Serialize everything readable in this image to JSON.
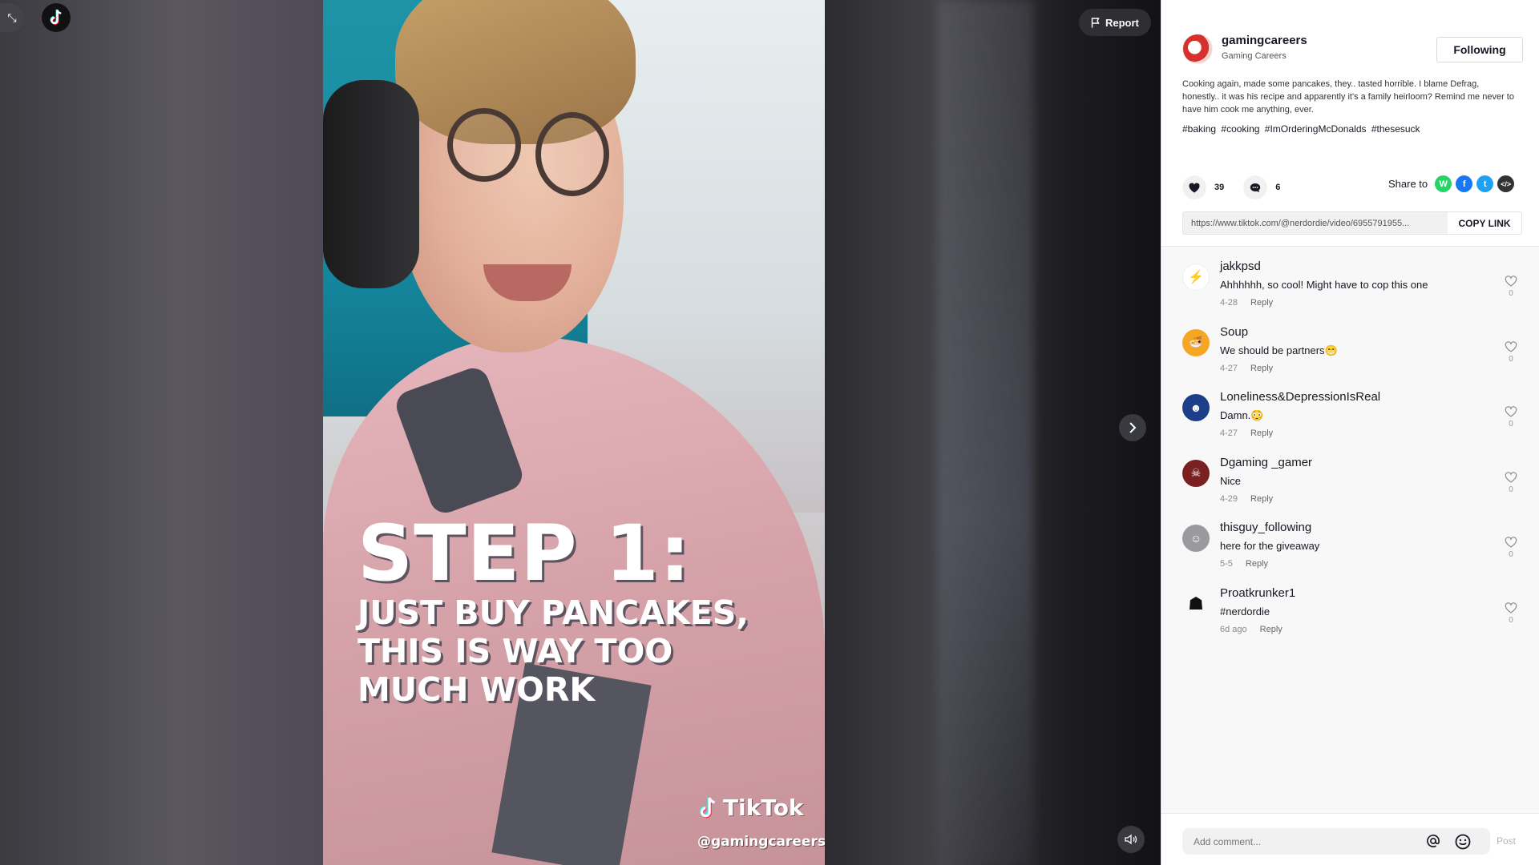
{
  "player": {
    "overlay_title": "STEP 1:",
    "overlay_lines": [
      "JUST BUY PANCAKES,",
      "THIS IS WAY TOO",
      "MUCH WORK"
    ],
    "watermark_brand": "TikTok",
    "watermark_handle": "@gamingcareers",
    "report_label": "Report"
  },
  "post": {
    "username": "gamingcareers",
    "nickname": "Gaming Careers",
    "follow_label": "Following",
    "description": "Cooking again, made some pancakes, they.. tasted horrible. I blame Defrag, honestly.. it was his recipe and apparently it's a family heirloom? Remind me never to have him cook me anything, ever.",
    "hashtags": [
      "#baking",
      "#cooking",
      "#ImOrderingMcDonalds",
      "#thesesuck"
    ],
    "likes": "39",
    "comments_count": "6",
    "share_label": "Share to",
    "link_url": "https://www.tiktok.com/@nerdordie/video/6955791955...",
    "copy_link_label": "COPY LINK"
  },
  "comments": [
    {
      "name": "jakkpsd",
      "text": "Ahhhhhh, so cool! Might have to cop this one",
      "date": "4-28",
      "reply": "Reply",
      "likes": "0"
    },
    {
      "name": "Soup",
      "text": "We should be partners😁",
      "date": "4-27",
      "reply": "Reply",
      "likes": "0"
    },
    {
      "name": "Loneliness&DepressionIsReal",
      "text": "Damn.😳",
      "date": "4-27",
      "reply": "Reply",
      "likes": "0"
    },
    {
      "name": "Dgaming _gamer",
      "text": "Nice",
      "date": "4-29",
      "reply": "Reply",
      "likes": "0"
    },
    {
      "name": "thisguy_following",
      "text": "here for the giveaway",
      "date": "5-5",
      "reply": "Reply",
      "likes": "0"
    },
    {
      "name": "Proatkrunker1",
      "text": "#nerdordie",
      "date": "6d ago",
      "reply": "Reply",
      "likes": "0"
    }
  ],
  "compose": {
    "placeholder": "Add comment...",
    "post_label": "Post"
  },
  "colors": {
    "whatsapp": "#25d366",
    "facebook": "#1877f2",
    "twitter": "#1da1f2",
    "embed": "#333333",
    "soup_avatar": "#f5a623",
    "lonely_avatar": "#1d3f8a",
    "dgaming_avatar": "#7a2020"
  }
}
